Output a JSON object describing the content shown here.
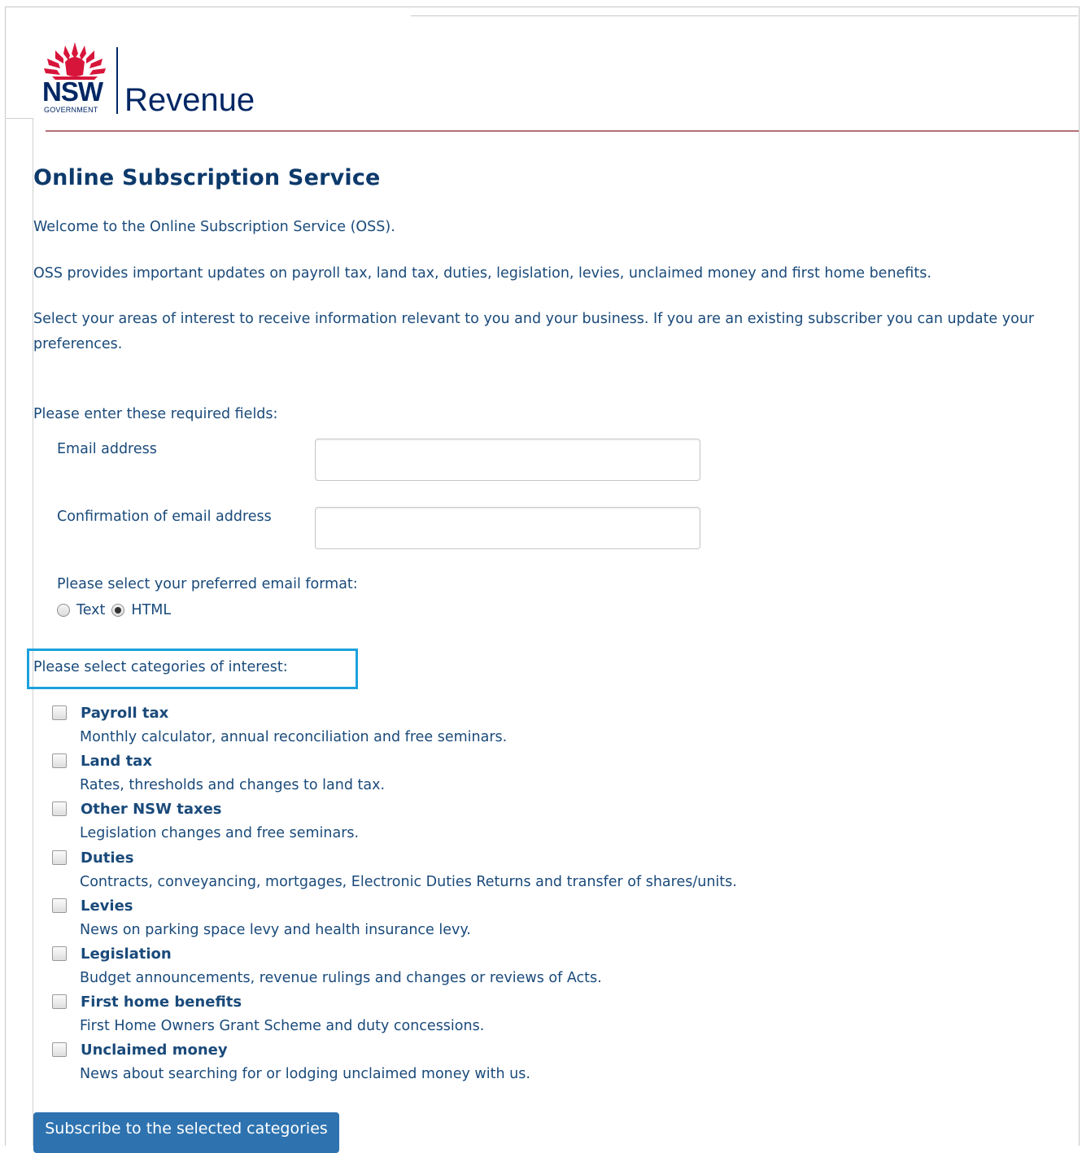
{
  "brand": {
    "logo_text": "NSW",
    "logo_subtext": "GOVERNMENT",
    "agency": "Revenue",
    "colors": {
      "navy": "#002664",
      "waratah_red": "#d7153a"
    }
  },
  "page": {
    "title": "Online Subscription Service",
    "welcome": "Welcome to the Online Subscription Service (OSS).",
    "intro": "OSS provides important updates on payroll tax, land tax, duties, legislation, levies, unclaimed money and first home benefits.",
    "instructions": "Select your areas of interest to receive information relevant to you and your business. If you are an existing subscriber you can update your preferences."
  },
  "form": {
    "required_prompt": "Please enter these required fields:",
    "email_label": "Email address",
    "email_value": "",
    "confirm_label": "Confirmation of email address",
    "confirm_value": "",
    "format_prompt": "Please select your preferred email format:",
    "format_options": [
      {
        "label": "Text",
        "selected": false
      },
      {
        "label": "HTML",
        "selected": true
      }
    ],
    "categories_prompt": "Please select categories of interest:",
    "highlight_color": "#1ba1dc",
    "categories": [
      {
        "name": "Payroll tax",
        "description": "Monthly calculator, annual reconciliation and free seminars.",
        "checked": false
      },
      {
        "name": "Land tax",
        "description": "Rates, thresholds and changes to land tax.",
        "checked": false
      },
      {
        "name": "Other NSW taxes",
        "description": "Legislation changes and free seminars.",
        "checked": false
      },
      {
        "name": "Duties",
        "description": "Contracts, conveyancing, mortgages, Electronic Duties Returns and transfer of shares/units.",
        "checked": false
      },
      {
        "name": "Levies",
        "description": "News on parking space levy and health insurance levy.",
        "checked": false
      },
      {
        "name": "Legislation",
        "description": "Budget announcements, revenue rulings and changes or reviews of Acts.",
        "checked": false
      },
      {
        "name": "First home benefits",
        "description": "First Home Owners Grant Scheme and duty concessions.",
        "checked": false
      },
      {
        "name": "Unclaimed money",
        "description": "News about searching for or lodging unclaimed money with us.",
        "checked": false
      }
    ],
    "submit_label": "Subscribe to the selected categories"
  }
}
